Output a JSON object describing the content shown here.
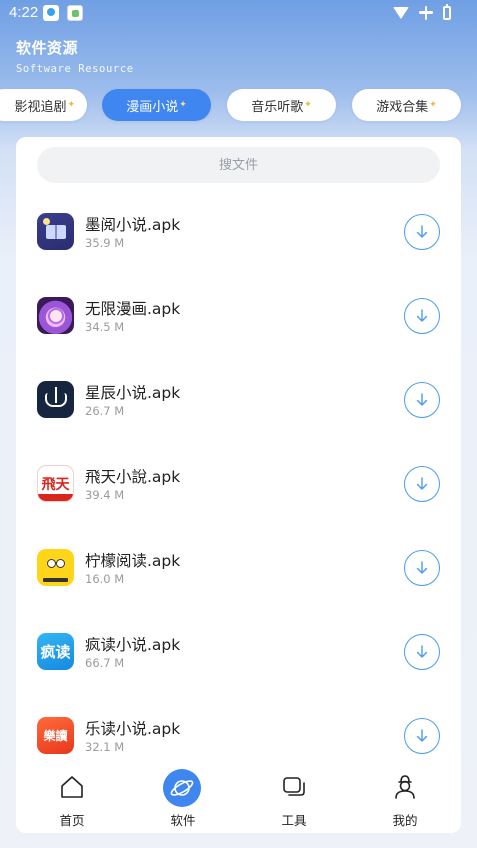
{
  "status_bar": {
    "time": "4:22"
  },
  "header": {
    "title": "软件资源",
    "subtitle": "Software Resource"
  },
  "tabs": [
    {
      "label": "影视追剧",
      "active": false
    },
    {
      "label": "漫画小说",
      "active": true
    },
    {
      "label": "音乐听歌",
      "active": false
    },
    {
      "label": "游戏合集",
      "active": false
    }
  ],
  "search": {
    "placeholder": "搜文件"
  },
  "files": [
    {
      "name": "墨阅小说.apk",
      "size": "35.9 M",
      "icon": "moyue-app-icon"
    },
    {
      "name": "无限漫画.apk",
      "size": "34.5 M",
      "icon": "wuxian-manhua-app-icon"
    },
    {
      "name": "星辰小说.apk",
      "size": "26.7 M",
      "icon": "xingchen-app-icon"
    },
    {
      "name": "飛天小說.apk",
      "size": "39.4 M",
      "icon": "feitian-app-icon",
      "icon_text": "飛天"
    },
    {
      "name": "柠檬阅读.apk",
      "size": "16.0 M",
      "icon": "ningmeng-app-icon"
    },
    {
      "name": "疯读小说.apk",
      "size": "66.7 M",
      "icon": "fengdu-app-icon",
      "icon_text": "疯读"
    },
    {
      "name": "乐读小说.apk",
      "size": "32.1 M",
      "icon": "ledu-app-icon",
      "icon_text": "樂讀"
    }
  ],
  "nav": [
    {
      "label": "首页",
      "icon": "home-icon",
      "active": false
    },
    {
      "label": "软件",
      "icon": "planet-icon",
      "active": true
    },
    {
      "label": "工具",
      "icon": "tools-icon",
      "active": false
    },
    {
      "label": "我的",
      "icon": "profile-icon",
      "active": false
    }
  ],
  "colors": {
    "accent": "#3f86f0",
    "download_ring": "#4a9bf2"
  }
}
